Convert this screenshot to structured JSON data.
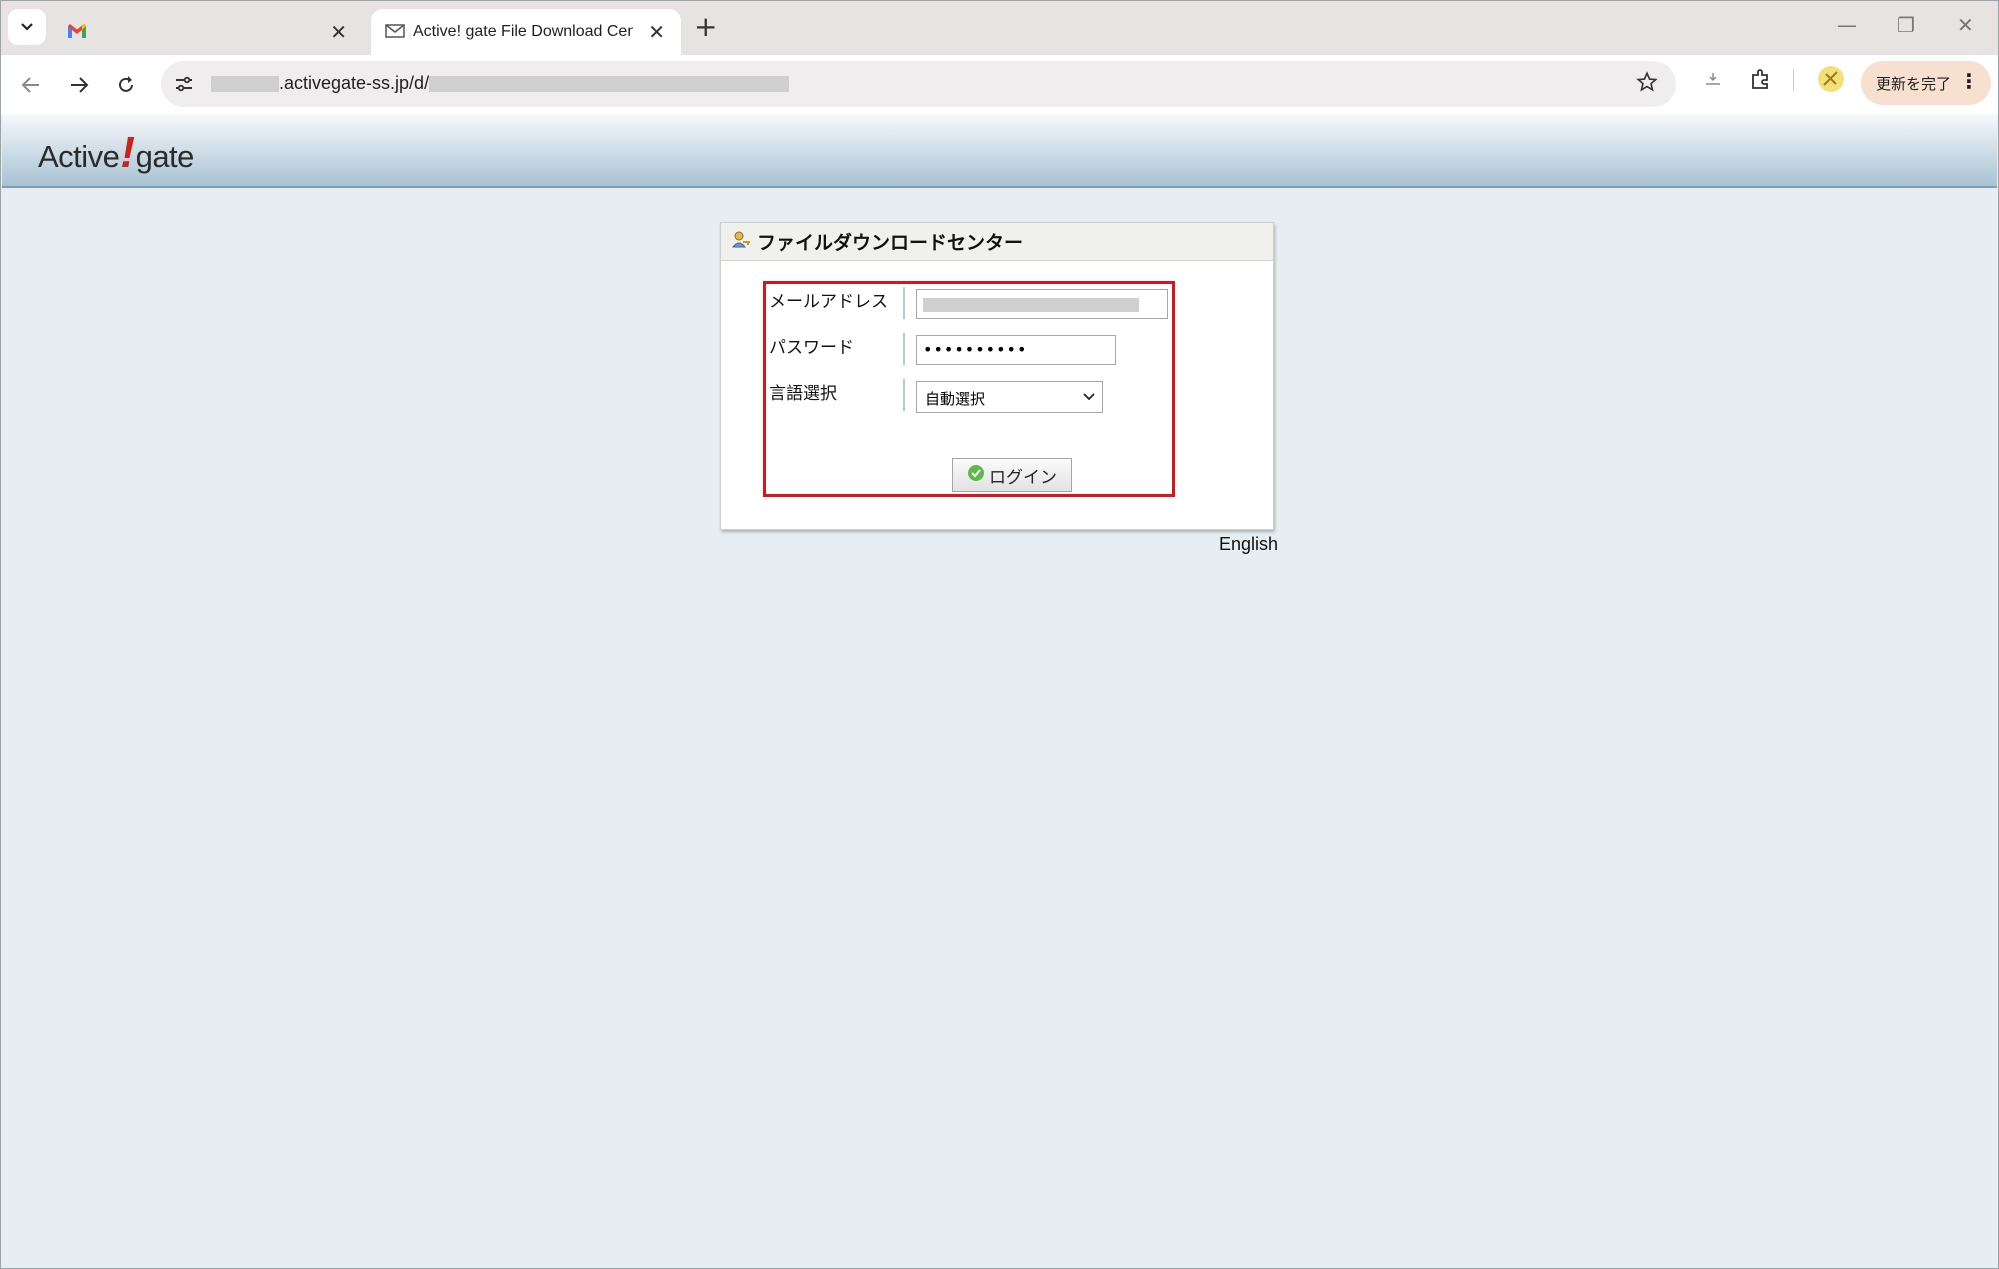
{
  "browser": {
    "tabs": [
      {
        "title": "",
        "favicon": "gmail-icon",
        "active": false
      },
      {
        "title": "Active! gate File Download Center",
        "favicon": "mail-icon",
        "active": true
      }
    ],
    "url_domain": ".activegate-ss.jp/d/",
    "update_label": "更新を完了"
  },
  "header": {
    "logo_left": "Active",
    "logo_bang": "!",
    "logo_right": "gate"
  },
  "panel": {
    "title": "ファイルダウンロードセンター",
    "email_label": "メールアドレス",
    "password_label": "パスワード",
    "password_value": "••••••••••",
    "language_label": "言語選択",
    "language_value": "自動選択",
    "login_label": "ログイン"
  },
  "footer": {
    "language_link": "English"
  },
  "colors": {
    "highlight_box": "#d9141e",
    "page_background": "#e6eef2"
  }
}
